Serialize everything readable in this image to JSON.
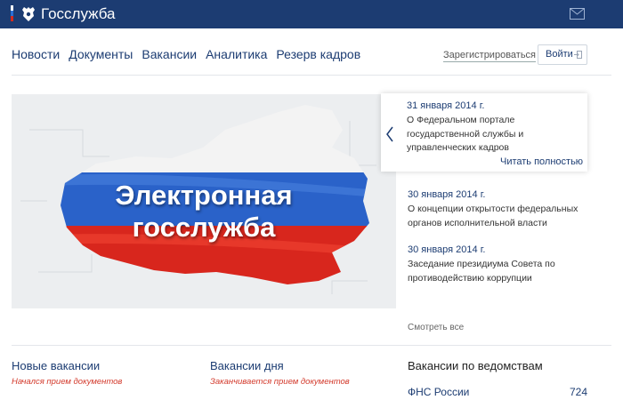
{
  "header": {
    "brand": "Госслужба",
    "colors": {
      "bar": "#1c3c72",
      "flag": [
        "#ffffff",
        "#2a6fd6",
        "#d52b1e"
      ]
    },
    "icons": [
      "coat-of-arms-icon",
      "mail-icon"
    ]
  },
  "nav": {
    "items": [
      "Новости",
      "Документы",
      "Вакансии",
      "Аналитика",
      "Резерв кадров"
    ],
    "register": "Зарегистрироваться",
    "login": "Войти"
  },
  "banner": {
    "title_line1": "Электронная",
    "title_line2": "госслужба"
  },
  "news": [
    {
      "date": "31 января 2014 г.",
      "text": "О Федеральном портале государственной службы и управленческих кадров",
      "link": "Читать полностью"
    },
    {
      "date": "30 января 2014 г.",
      "text": "О концепции открытости федеральных органов исполнительной власти"
    },
    {
      "date": "30 января 2014 г.",
      "text": "Заседание президиума Совета по противодействию коррупции"
    }
  ],
  "see_all": "Смотреть все",
  "bottom": {
    "new_vacancies": {
      "title": "Новые вакансии",
      "note": "Начался прием документов"
    },
    "day_vacancies": {
      "title": "Вакансии дня",
      "note": "Заканчивается прием документов"
    },
    "by_department": {
      "title": "Вакансии по ведомствам",
      "items": [
        {
          "name": "ФНС России",
          "count": "724"
        }
      ]
    }
  }
}
